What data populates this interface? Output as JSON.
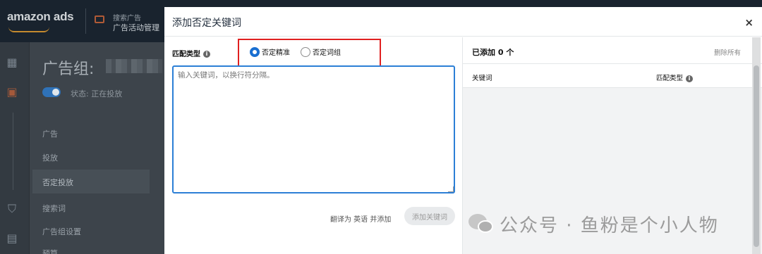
{
  "app": {
    "logo_text": "amazon ads",
    "breadcrumb_top": "搜索广告",
    "breadcrumb_bottom": "广告活动管理"
  },
  "background_page": {
    "title": "广告组:",
    "status": "状态: 正在投放",
    "nav_items": [
      "广告",
      "投放",
      "否定投放",
      "搜索词",
      "广告组设置",
      "预算"
    ]
  },
  "modal": {
    "title": "添加否定关键词",
    "close_label": "×",
    "match_type_label": "匹配类型",
    "info_glyph": "i",
    "radio_options": [
      {
        "label": "否定精准",
        "checked": true
      },
      {
        "label": "否定词组",
        "checked": false
      }
    ],
    "textarea_placeholder": "输入关键词，以换行符分隔。",
    "translate_link": "翻译为 英语 并添加",
    "add_button": "添加关键词",
    "added_panel": {
      "count_label": "已添加 0 个",
      "remove_all": "删除所有",
      "col_keyword": "关键词",
      "col_match": "匹配类型"
    }
  },
  "watermark": {
    "text": "公众号 · 鱼粉是个小人物"
  },
  "colors": {
    "accent": "#1a6fd1",
    "highlight_box": "#e02020",
    "topbar": "#19232e"
  }
}
